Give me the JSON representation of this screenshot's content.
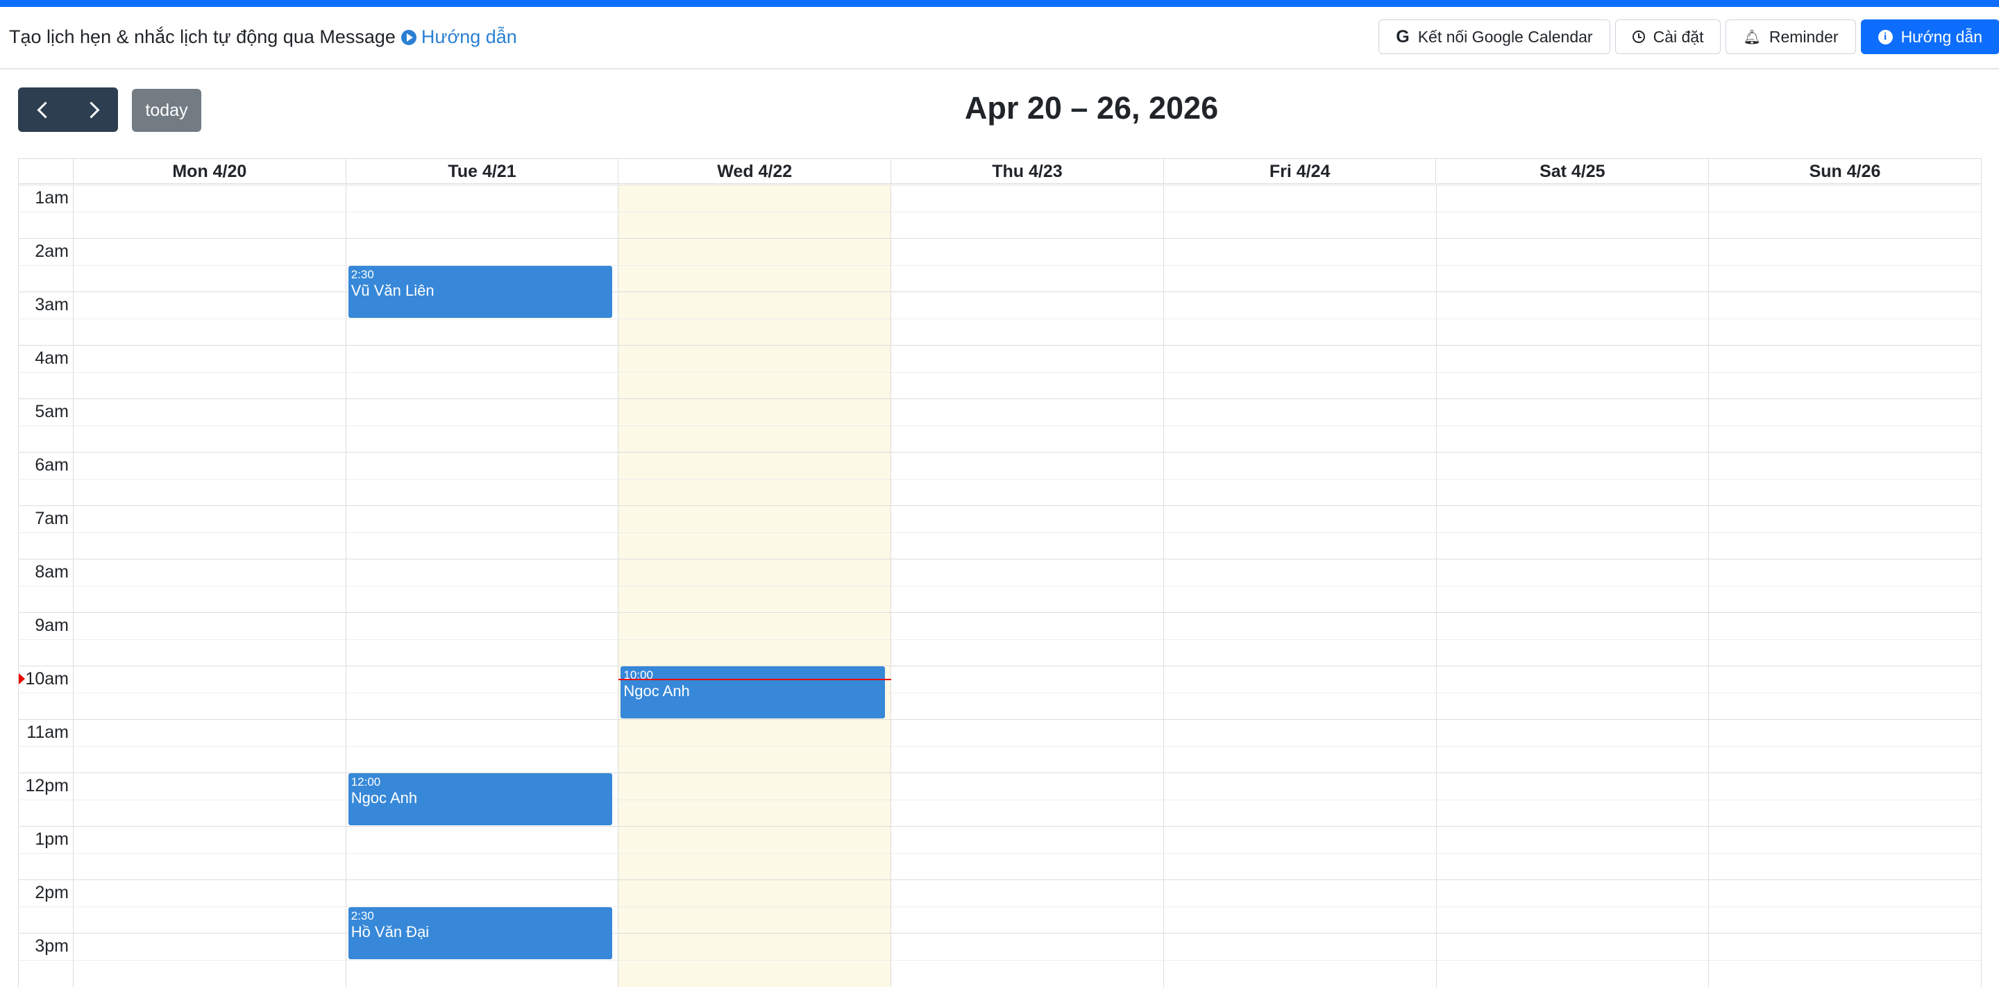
{
  "header": {
    "title": "Tạo lịch hẹn & nhắc lịch tự động qua Message",
    "guide_link": "Hướng dẫn",
    "buttons": {
      "google": "Kết nối Google Calendar",
      "settings": "Cài đặt",
      "reminder": "Reminder",
      "guide": "Hướng dẫn"
    }
  },
  "toolbar": {
    "today_label": "today",
    "range_title": "Apr 20 – 26, 2026"
  },
  "calendar": {
    "days": [
      "Mon 4/20",
      "Tue 4/21",
      "Wed 4/22",
      "Thu 4/23",
      "Fri 4/24",
      "Sat 4/25",
      "Sun 4/26"
    ],
    "today_index": 2,
    "hours": [
      "1am",
      "2am",
      "3am",
      "4am",
      "5am",
      "6am",
      "7am",
      "8am",
      "9am",
      "10am",
      "11am",
      "12pm",
      "1pm",
      "2pm",
      "3pm"
    ],
    "now_time": "10:15",
    "events": [
      {
        "day": 1,
        "start": "2:30",
        "end": "3:30",
        "time_label": "2:30",
        "title": "Vũ Văn Liên"
      },
      {
        "day": 1,
        "start": "12:00",
        "end": "13:00",
        "time_label": "12:00",
        "title": "Ngoc Anh"
      },
      {
        "day": 1,
        "start": "14:30",
        "end": "15:30",
        "time_label": "2:30",
        "title": "Hồ Văn Đại"
      },
      {
        "day": 2,
        "start": "10:00",
        "end": "11:00",
        "time_label": "10:00",
        "title": "Ngoc Anh"
      }
    ]
  },
  "colors": {
    "accent": "#0d6efd",
    "event": "#3788d8",
    "today_bg": "#fcf8e3",
    "nav_button": "#2c3e50",
    "now_indicator": "#ee0000"
  }
}
